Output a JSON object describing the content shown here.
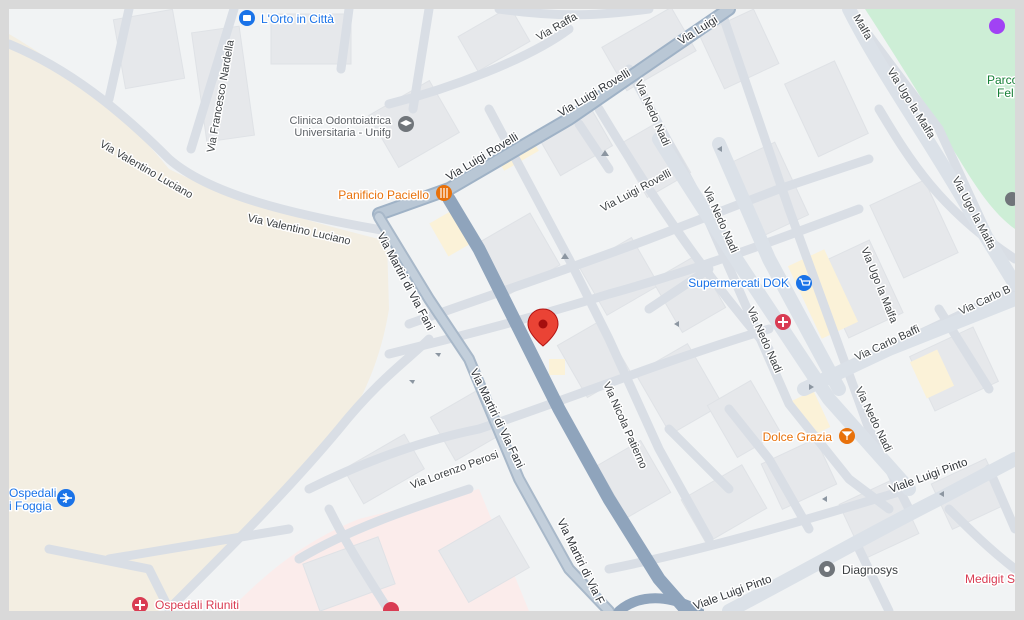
{
  "map": {
    "colors": {
      "background": "#f1f3f4",
      "sand_area": "#f3eee2",
      "park": "#cdeed6",
      "hospital_area": "#fbeceb",
      "minor_road": "#d9dee5",
      "major_road": "#8fa4bc",
      "building": "#e6e8eb",
      "selected_pin": "#ea4335",
      "poi_blue": "#1a73e8",
      "poi_orange": "#e8710a",
      "poi_red": "#d93c53",
      "poi_purple": "#a142f4",
      "poi_gray": "#70757a"
    },
    "streets": {
      "via_luigi_rovelli_1": "Via Luigi Rovelli",
      "via_luigi_rovelli_2": "Via Luigi Rovelli",
      "via_luigi_top": "Via Luigi",
      "via_raffa": "Via Raffa",
      "via_luigi_rovelli_small": "Via Luigi Rovelli",
      "via_francesco_nardella": "Via Francesco Nardella",
      "via_valentino_luciano_1": "Via Valentino Luciano",
      "via_valentino_luciano_2": "Via Valentino Luciano",
      "via_martiri_di_via_fani_1": "Via Martiri di Via Fani",
      "via_martiri_di_via_fani_2": "Via Martiri di Via Fani",
      "via_martiri_di_via_fani_3": "Via Martiri di Via F",
      "via_nedo_nadi_1": "Via Nedo Nadi",
      "via_nedo_nadi_2": "Via Nedo Nadi",
      "via_nedo_nadi_3": "Via Nedo Nadi",
      "via_nedo_nadi_4": "Via Nedo Nadi",
      "via_ugo_la_malfa_1": "Via Ugo la Malfa",
      "via_ugo_la_malfa_2": "Via Ugo la Malfa",
      "via_ugo_la_malfa_3": "Via Ugo la Malfa",
      "via_malfa_top": "Malfa",
      "via_carlo_baffi": "Via Carlo Baffi",
      "via_carlo_b": "Via Carlo B",
      "via_nicola_patierno": "Via Nicola Patierno",
      "via_lorenzo_perosi": "Via Lorenzo Perosi",
      "viale_luigi_pinto_1": "Viale Luigi Pinto",
      "viale_luigi_pinto_2": "Viale Luigi Pinto"
    },
    "pois": {
      "orto": "L'Orto in Città",
      "clinica_1": "Clinica Odontoiatrica",
      "clinica_2": "Universitaria - Unifg",
      "panificio": "Panificio Paciello",
      "supermercati": "Supermercati DOK",
      "dolce_grazia": "Dolce Grazia",
      "diagnosys": "Diagnosys",
      "medigit": "Medigit S",
      "ospedali_riuniti": "Ospedali Riuniti",
      "ospedali_foggia_1": "Ospedali",
      "ospedali_foggia_2": "i Foggia",
      "parco_1": "Parco",
      "parco_2": "Fel"
    },
    "icons": {
      "orto": "shopping-bag-icon",
      "clinica": "graduation-cap-icon",
      "panificio": "restaurant-icon",
      "supermercati": "shopping-cart-icon",
      "dolce_grazia": "cocktail-icon",
      "diagnosys": "place-icon",
      "hospital": "hospital-icon",
      "airport": "airplane-icon",
      "selected": "map-pin-icon"
    }
  }
}
